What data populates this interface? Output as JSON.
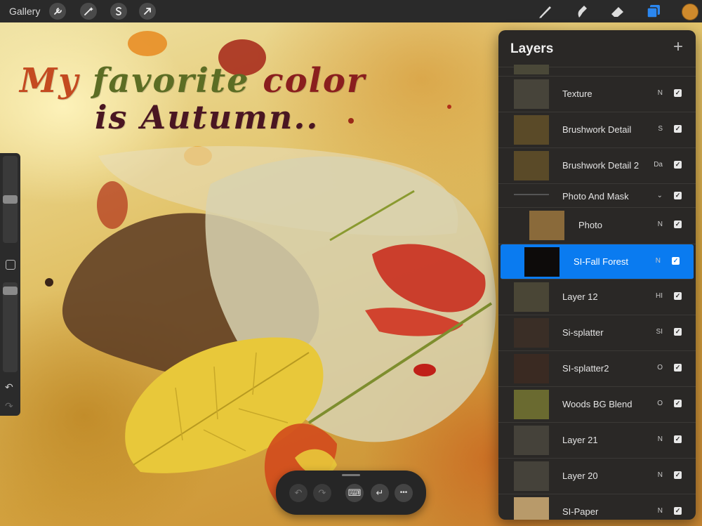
{
  "toolbar": {
    "gallery_label": "Gallery",
    "left_tools": [
      {
        "name": "wrench-icon",
        "glyph": "🔧"
      },
      {
        "name": "magic-wand-icon",
        "glyph": "✦"
      },
      {
        "name": "selection-s-icon",
        "glyph": "S"
      },
      {
        "name": "transform-arrow-icon",
        "glyph": "➚"
      }
    ],
    "right_tools": [
      "brush-icon",
      "smudge-icon",
      "eraser-icon",
      "layers-icon"
    ],
    "active_color": "#cf8a2c",
    "layers_active_color": "#2b87f0"
  },
  "canvas": {
    "title_line1": [
      "My ",
      "favorite ",
      "color"
    ],
    "title_line2": "is Autumn.."
  },
  "sidebar": {
    "brush_size_level": 0.5,
    "opacity_level": 0.0,
    "undo_icon": "↶",
    "redo_icon": "↷"
  },
  "layers": {
    "title": "Layers",
    "add_icon": "+",
    "items": [
      {
        "name": "Texture",
        "mode": "N",
        "visible": true
      },
      {
        "name": "Brushwork Detail",
        "mode": "S",
        "visible": true
      },
      {
        "name": "Brushwork Detail 2",
        "mode": "Da",
        "visible": true
      },
      {
        "name": "Photo And Mask",
        "mode": "⌄",
        "visible": true,
        "group": true
      },
      {
        "name": "Photo",
        "mode": "N",
        "visible": true
      },
      {
        "name": "SI-Fall Forest",
        "mode": "N",
        "visible": true,
        "selected": true
      },
      {
        "name": "Layer 12",
        "mode": "HI",
        "visible": true
      },
      {
        "name": "Si-splatter",
        "mode": "SI",
        "visible": true
      },
      {
        "name": "SI-splatter2",
        "mode": "O",
        "visible": true
      },
      {
        "name": "Woods BG Blend",
        "mode": "O",
        "visible": true
      },
      {
        "name": "Layer 21",
        "mode": "N",
        "visible": true
      },
      {
        "name": "Layer 20",
        "mode": "N",
        "visible": true
      },
      {
        "name": "SI-Paper",
        "mode": "N",
        "visible": true
      }
    ]
  },
  "keyboard_bar": {
    "undo_icon": "↶",
    "redo_icon": "↷",
    "keyboard_icon": "⌨",
    "return_icon": "↵",
    "more_icon": "•••"
  }
}
